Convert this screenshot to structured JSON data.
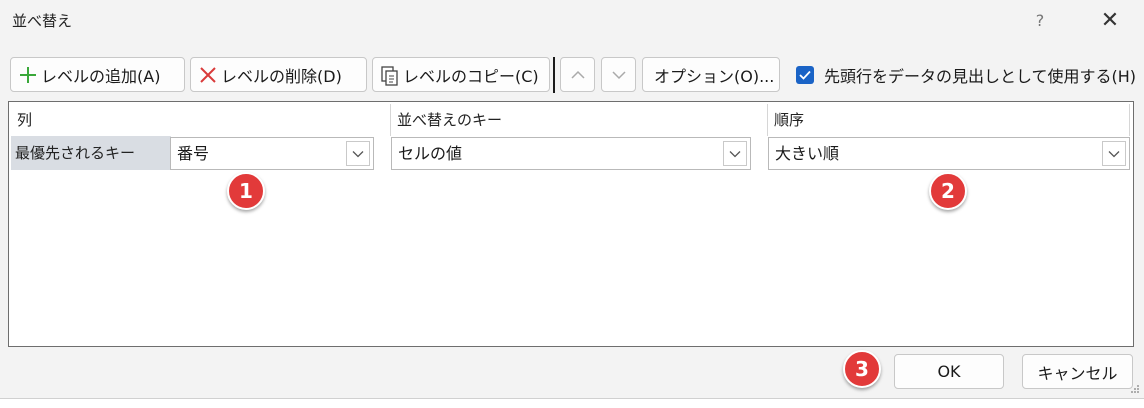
{
  "dialog": {
    "title": "並べ替え",
    "help": "?",
    "close": "✕"
  },
  "toolbar": {
    "add_level": "レベルの追加(A)",
    "delete_level": "レベルの削除(D)",
    "copy_level": "レベルのコピー(C)",
    "move_up": "up",
    "move_down": "down",
    "options": "オプション(O)...",
    "header_checkbox": {
      "label": "先頭行をデータの見出しとして使用する(H)",
      "checked": true
    }
  },
  "grid": {
    "columns": [
      "列",
      "並べ替えのキー",
      "順序"
    ],
    "rows": [
      {
        "label": "最優先されるキー",
        "column": "番号",
        "sort_on": "セルの値",
        "order": "大きい順"
      }
    ]
  },
  "annotations": [
    "1",
    "2",
    "3"
  ],
  "footer": {
    "ok": "OK",
    "cancel": "キャンセル"
  },
  "colors": {
    "accent": "#1a63c6",
    "badge": "#e23a3a",
    "add_icon": "#3aa83a",
    "delete_icon": "#d93a3a"
  }
}
